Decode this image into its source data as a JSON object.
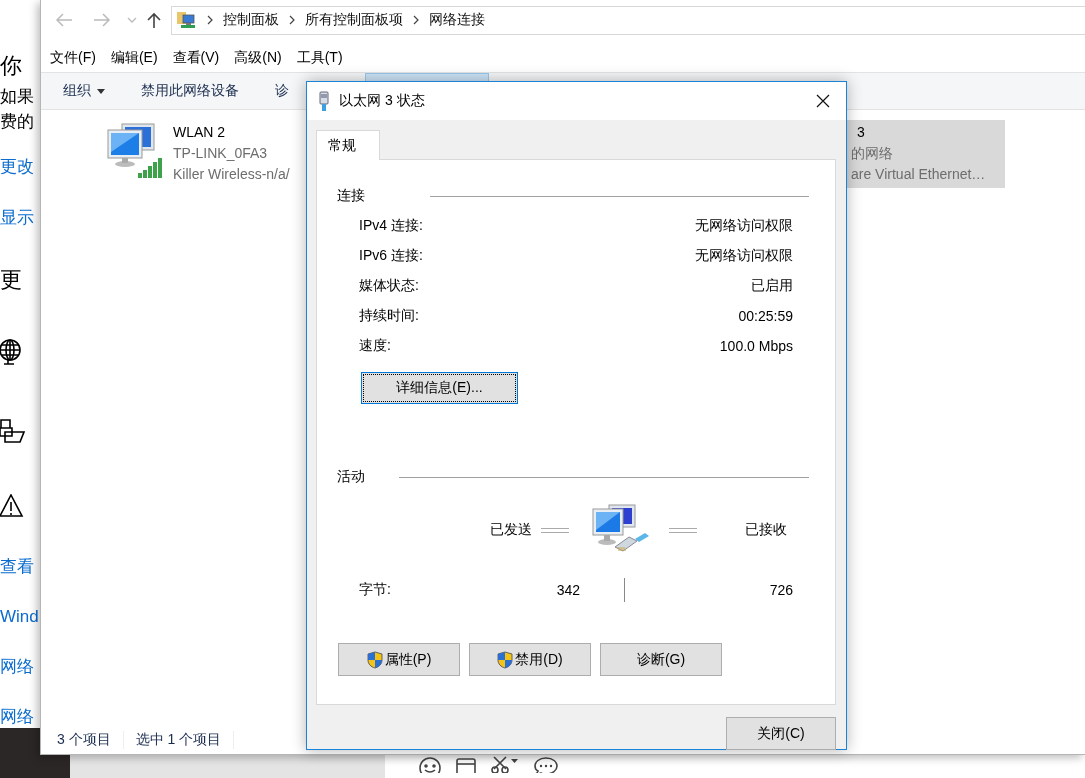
{
  "background_page": {
    "items": [
      {
        "kind": "heading",
        "text": "你"
      },
      {
        "kind": "text",
        "text": "如果"
      },
      {
        "kind": "text",
        "text": "费的"
      },
      {
        "kind": "link",
        "text": "更改"
      },
      {
        "kind": "link",
        "text": "显示"
      },
      {
        "kind": "heading",
        "text": "更"
      },
      {
        "kind": "globe"
      },
      {
        "kind": "devices"
      },
      {
        "kind": "warning"
      },
      {
        "kind": "link",
        "text": "查看"
      },
      {
        "kind": "link",
        "text": "Wind"
      },
      {
        "kind": "link",
        "text": "网络"
      },
      {
        "kind": "link",
        "text": "网络"
      }
    ]
  },
  "explorer": {
    "address": [
      "控制面板",
      "所有控制面板项",
      "网络连接"
    ],
    "menu": [
      "文件(F)",
      "编辑(E)",
      "查看(V)",
      "高级(N)",
      "工具(T)"
    ],
    "toolbar": [
      {
        "label": "组织",
        "dropdown": true,
        "highlighted": false
      },
      {
        "label": "禁用此网络设备",
        "dropdown": false,
        "highlighted": false
      },
      {
        "label": "诊",
        "dropdown": false,
        "highlighted": false
      },
      {
        "dropdown": false,
        "highlighted": true
      }
    ],
    "connections": [
      {
        "kind": "wireless",
        "name": "WLAN 2",
        "network": "TP-LINK_0FA3",
        "adapter": "Killer Wireless-n/a/",
        "selected": false
      },
      {
        "kind": "hidden",
        "name": "3",
        "network": "的网络",
        "adapter": "are Virtual Ethernet…",
        "selected": true
      }
    ],
    "status_bar": [
      "3 个项目",
      "选中 1 个项目"
    ]
  },
  "dialog": {
    "title": "以太网 3 状态",
    "tabs": [
      {
        "label": "常规",
        "selected": true
      }
    ],
    "connection": {
      "heading": "连接",
      "rows": [
        {
          "label": "IPv4 连接:",
          "value": "无网络访问权限"
        },
        {
          "label": "IPv6 连接:",
          "value": "无网络访问权限"
        },
        {
          "label": "媒体状态:",
          "value": "已启用"
        },
        {
          "label": "持续时间:",
          "value": "00:25:59"
        },
        {
          "label": "速度:",
          "value": "100.0 Mbps"
        }
      ],
      "details_button": "详细信息(E)..."
    },
    "activity": {
      "heading": "活动",
      "sent_label": "已发送",
      "received_label": "已接收",
      "bytes_label": "字节:",
      "bytes_sent": "342",
      "bytes_received": "726"
    },
    "buttons": [
      {
        "label": "属性(P)",
        "shield": true
      },
      {
        "label": "禁用(D)",
        "shield": true
      },
      {
        "label": "诊断(G)",
        "shield": false
      }
    ],
    "close_button": "关闭(C)"
  }
}
